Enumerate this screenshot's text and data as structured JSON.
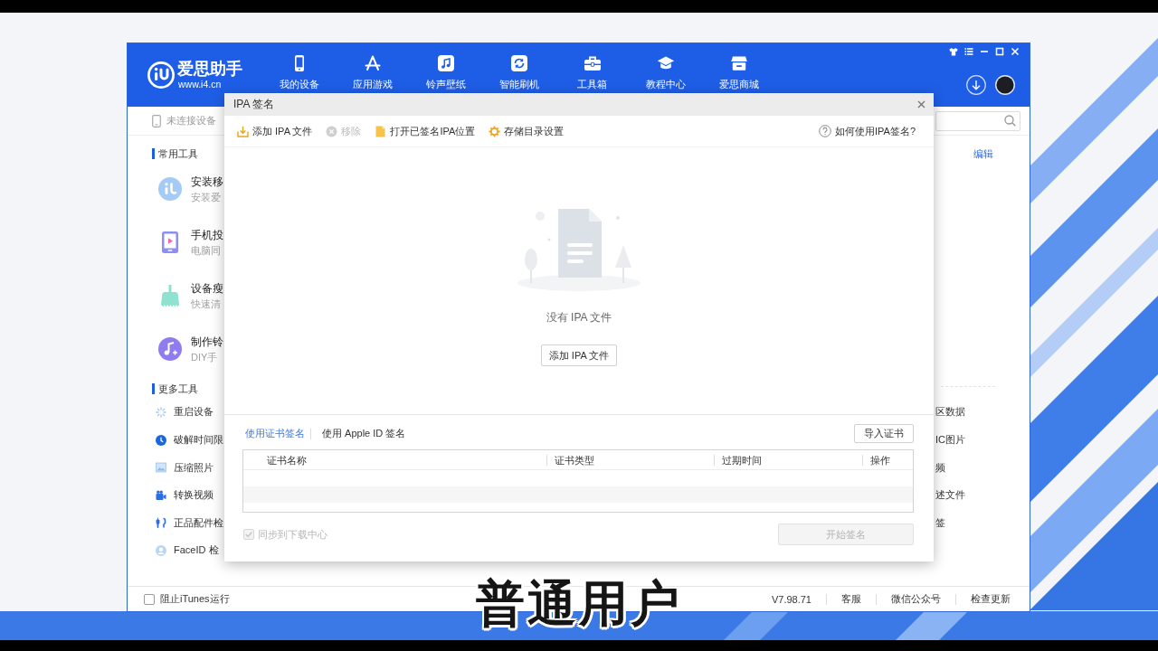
{
  "header": {
    "logo": {
      "name": "爱思助手",
      "url": "www.i4.cn"
    },
    "nav": [
      "我的设备",
      "应用游戏",
      "铃声壁纸",
      "智能刷机",
      "工具箱",
      "教程中心",
      "爱思商城"
    ]
  },
  "device_bar": {
    "status": "未连接设备"
  },
  "tools": {
    "common": {
      "title": "常用工具",
      "items": [
        {
          "title": "安装移",
          "subtitle": "安装爱"
        },
        {
          "title": "手机投",
          "subtitle": "电脑同"
        },
        {
          "title": "设备瘦",
          "subtitle": "快速清"
        },
        {
          "title": "制作铃",
          "subtitle": "DIY手"
        }
      ]
    },
    "more": {
      "title": "更多工具",
      "items": [
        "重启设备",
        "破解时间限",
        "压缩照片",
        "转换视频",
        "正品配件检",
        "FaceID 检"
      ]
    },
    "edit_link": "编辑",
    "more_right": [
      "区数据",
      "IC图片",
      "频",
      "述文件",
      "签"
    ]
  },
  "status_bar": {
    "block_itunes": {
      "label": "阻止iTunes运行",
      "checked": false
    },
    "version": "V7.98.71",
    "links": [
      "客服",
      "微信公众号",
      "检查更新"
    ]
  },
  "dialog": {
    "title": "IPA 签名",
    "toolbar": [
      {
        "label": "添加 IPA 文件",
        "disabled": false
      },
      {
        "label": "移除",
        "disabled": true
      },
      {
        "label": "打开已签名IPA位置",
        "disabled": false
      },
      {
        "label": "存储目录设置",
        "disabled": false
      }
    ],
    "help": "如何使用IPA签名?",
    "empty_message": "没有 IPA 文件",
    "add_button": "添加 IPA 文件",
    "tabs": [
      {
        "label": "使用证书签名",
        "selected": true
      },
      {
        "label": "使用 Apple ID 签名",
        "selected": false
      }
    ],
    "import_button": "导入证书",
    "table": {
      "columns": [
        "证书名称",
        "证书类型",
        "过期时间",
        "操作"
      ]
    },
    "sync": {
      "label": "同步到下载中心",
      "checked": true,
      "disabled": true
    },
    "start_button": {
      "label": "开始签名",
      "disabled": true
    }
  },
  "subtitle": "普通用户"
}
